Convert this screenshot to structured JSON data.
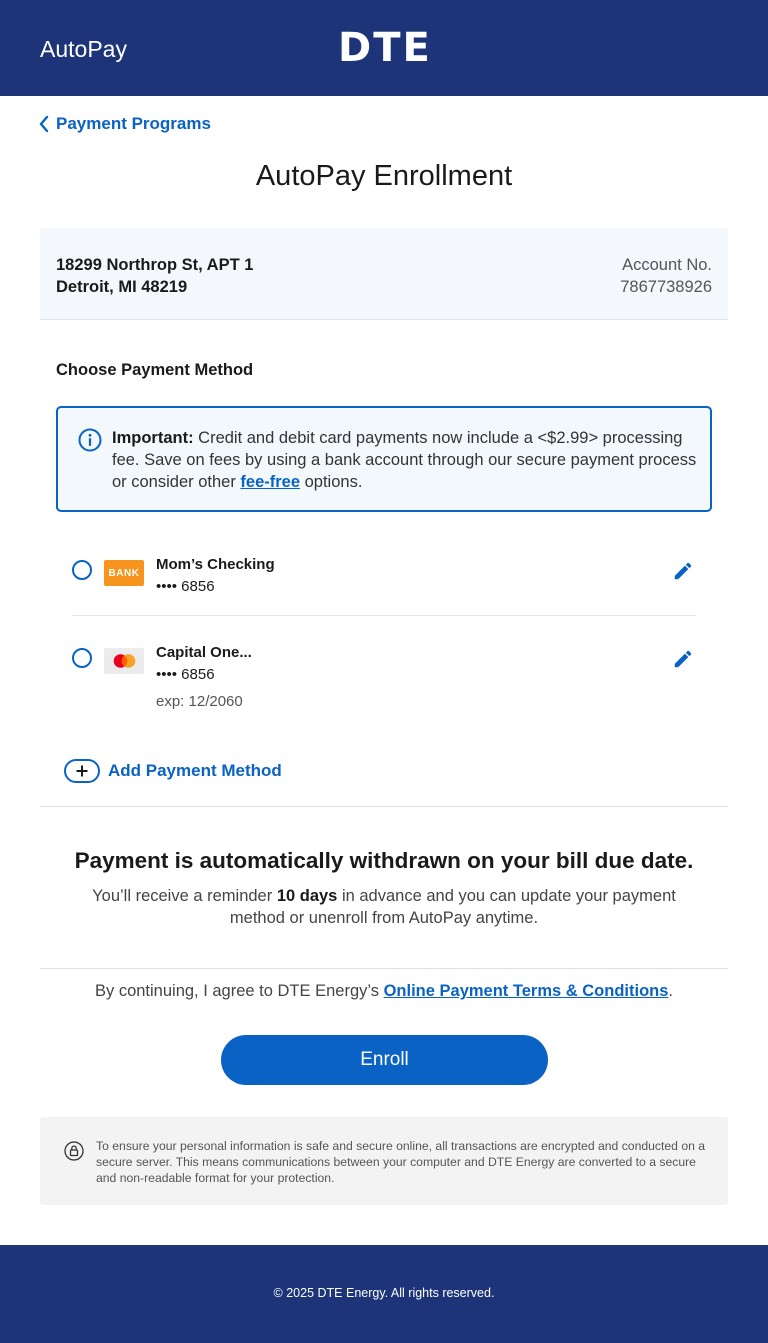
{
  "header": {
    "app_title": "AutoPay",
    "logo_text": "DTE"
  },
  "nav": {
    "back_label": "Payment Programs"
  },
  "page": {
    "title": "AutoPay Enrollment"
  },
  "account": {
    "address_line1": "18299 Northrop St, APT 1",
    "address_line2": "Detroit, MI 48219",
    "account_label": "Account No.",
    "account_number": "7867738926"
  },
  "payment": {
    "section_label": "Choose Payment Method",
    "notice": {
      "strong": "Important:",
      "text_before_link": " Credit and debit card payments now include a <$2.99> processing fee. Save on fees by using a bank account through our secure payment process or consider other ",
      "link": "fee-free",
      "text_after_link": " options."
    },
    "methods": [
      {
        "logo_text": "BANK",
        "name": "Mom’s Checking",
        "mask": "•••• 6856",
        "exp": ""
      },
      {
        "logo_text": "",
        "name": "Capital One...",
        "mask": "•••• 6856",
        "exp": "exp: 12/2060"
      }
    ],
    "add_label": "Add Payment Method"
  },
  "autopay_info": {
    "title": "Payment is automatically withdrawn on your bill due date.",
    "desc_before": "You’ll receive a reminder ",
    "desc_bold": "10 days",
    "desc_after": " in advance and you can update your payment method or unenroll from AutoPay anytime."
  },
  "terms": {
    "before": "By continuing, I agree to DTE Energy’s ",
    "link": "Online Payment Terms & Conditions",
    "after": "."
  },
  "enroll_label": "Enroll",
  "security_text": "To ensure your personal information is safe and secure online, all transactions are encrypted and conducted on a secure server. This means communications between your computer and DTE Energy are converted to a secure and non-readable format for your protection.",
  "footer": {
    "copyright": "© 2025 DTE Energy. All rights reserved."
  },
  "colors": {
    "brand_navy": "#1d3578",
    "accent_blue": "#0a62c4",
    "bank_orange": "#f7941d"
  },
  "icons": [
    "chevron-left-icon",
    "info-icon",
    "pencil-icon",
    "plus-circle-icon",
    "lock-icon",
    "mastercard-icon"
  ]
}
